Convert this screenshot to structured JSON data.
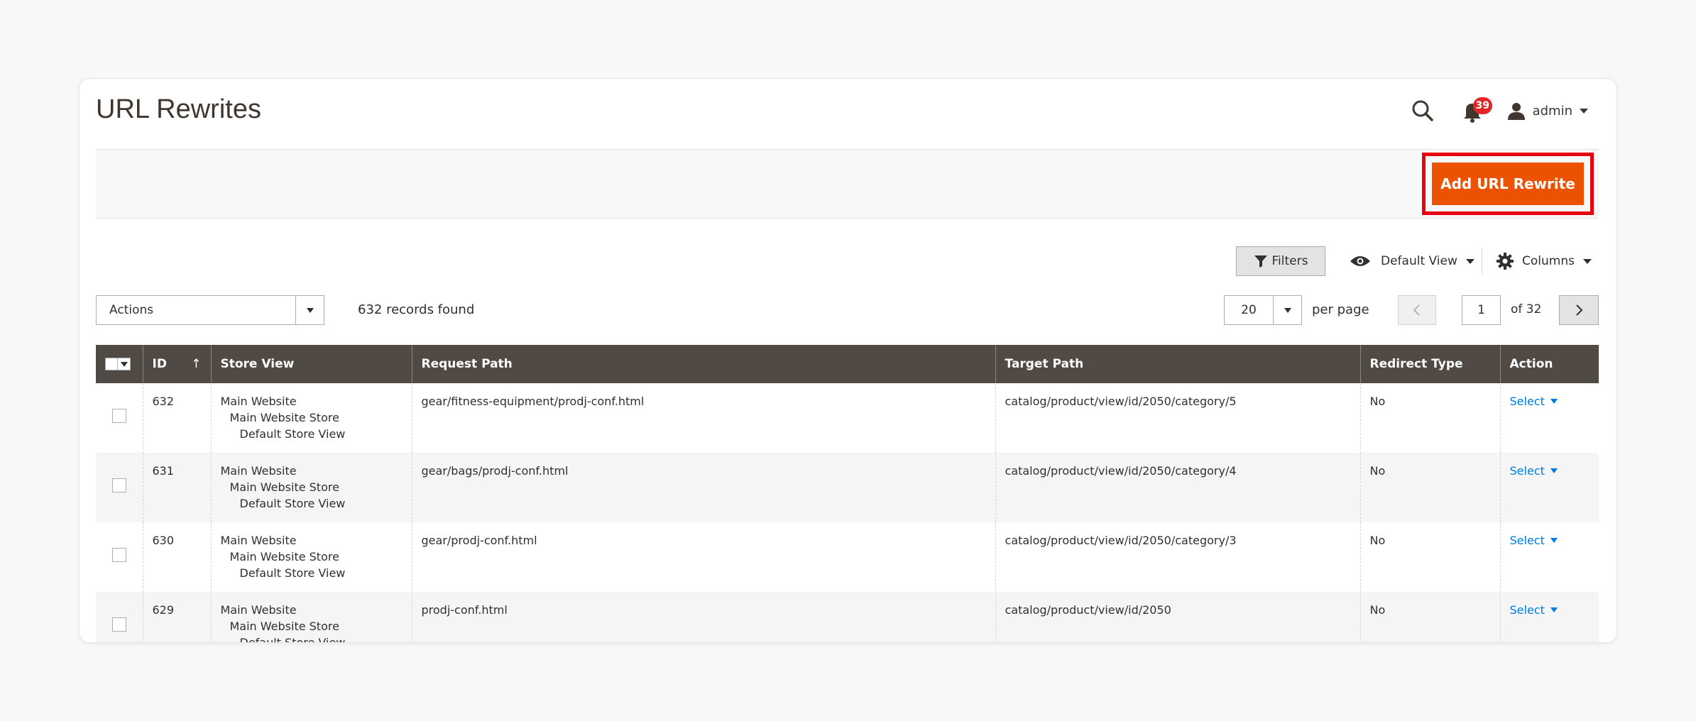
{
  "page": {
    "title": "URL Rewrites",
    "notifications_count": "39",
    "user_name": "admin"
  },
  "page_actions": {
    "add_button_label": "Add URL Rewrite"
  },
  "toolbar": {
    "filters_label": "Filters",
    "view_label": "Default View",
    "columns_label": "Columns",
    "actions_label": "Actions",
    "records_found": "632 records found",
    "per_page_value": "20",
    "per_page_label": "per page",
    "current_page": "1",
    "page_total": "of 32"
  },
  "grid": {
    "columns": {
      "id": "ID",
      "sort_indicator": "↑",
      "store_view": "Store View",
      "request_path": "Request Path",
      "target_path": "Target Path",
      "redirect_type": "Redirect Type",
      "action": "Action"
    },
    "rows": [
      {
        "id": "632",
        "store_website": "Main Website",
        "store_store": "Main Website Store",
        "store_view": "Default Store View",
        "request_path": "gear/fitness-equipment/prodj-conf.html",
        "target_path": "catalog/product/view/id/2050/category/5",
        "redirect_type": "No",
        "action": "Select"
      },
      {
        "id": "631",
        "store_website": "Main Website",
        "store_store": "Main Website Store",
        "store_view": "Default Store View",
        "request_path": "gear/bags/prodj-conf.html",
        "target_path": "catalog/product/view/id/2050/category/4",
        "redirect_type": "No",
        "action": "Select"
      },
      {
        "id": "630",
        "store_website": "Main Website",
        "store_store": "Main Website Store",
        "store_view": "Default Store View",
        "request_path": "gear/prodj-conf.html",
        "target_path": "catalog/product/view/id/2050/category/3",
        "redirect_type": "No",
        "action": "Select"
      },
      {
        "id": "629",
        "store_website": "Main Website",
        "store_store": "Main Website Store",
        "store_view": "Default Store View",
        "request_path": "prodj-conf.html",
        "target_path": "catalog/product/view/id/2050",
        "redirect_type": "No",
        "action": "Select"
      }
    ]
  },
  "colors": {
    "accent": "#eb5202",
    "highlight_border": "#e6000f",
    "header_bg": "#514943",
    "link": "#007bdb",
    "badge": "#e22626"
  },
  "icons": {
    "search": "search-icon",
    "notifications": "bell-icon",
    "user": "user-icon",
    "filter": "funnel-icon",
    "view": "eye-icon",
    "columns": "gear-icon"
  }
}
